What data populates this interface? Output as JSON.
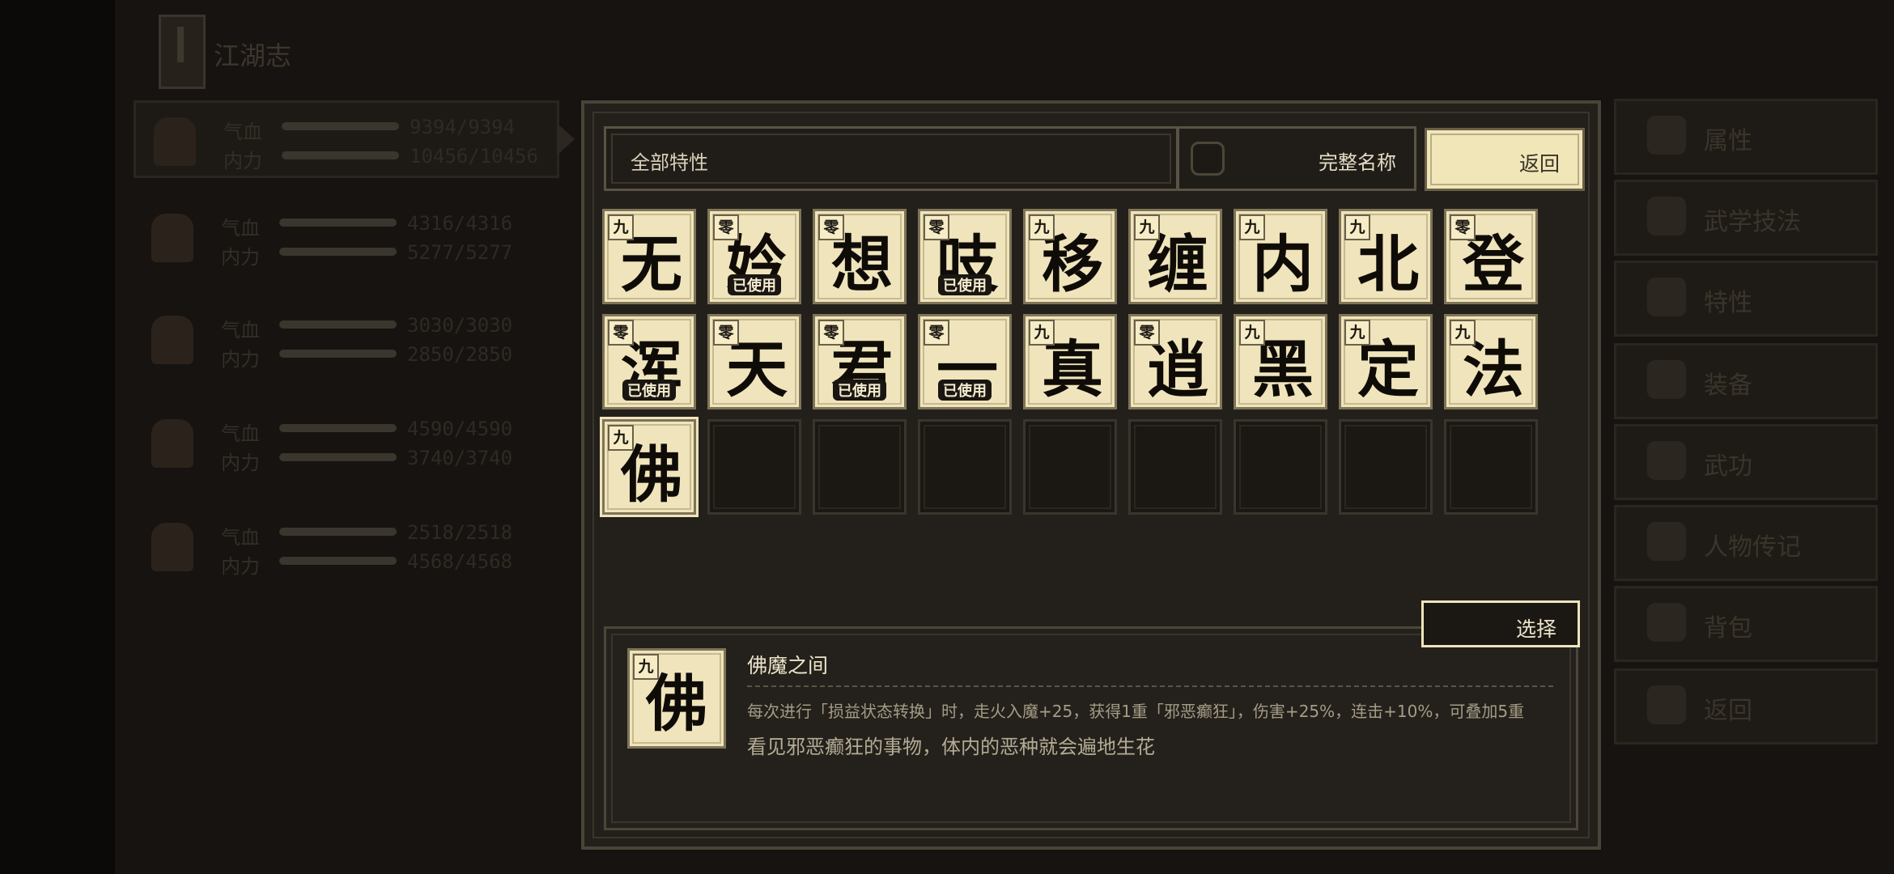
{
  "background": {
    "title": "江湖志",
    "party": [
      {
        "hp_label": "气血",
        "mp_label": "内力",
        "hp": "9394/9394",
        "mp": "10456/10456"
      },
      {
        "hp_label": "气血",
        "mp_label": "内力",
        "hp": "4316/4316",
        "mp": "5277/5277"
      },
      {
        "hp_label": "气血",
        "mp_label": "内力",
        "hp": "3030/3030",
        "mp": "2850/2850"
      },
      {
        "hp_label": "气血",
        "mp_label": "内力",
        "hp": "4590/4590",
        "mp": "3740/3740"
      },
      {
        "hp_label": "气血",
        "mp_label": "内力",
        "hp": "2518/2518",
        "mp": "4568/4568"
      }
    ],
    "menu": [
      "属性",
      "武学技法",
      "特性",
      "装备",
      "武功",
      "人物传记",
      "背包",
      "返回"
    ]
  },
  "modal": {
    "filter_label": "全部特性",
    "fullname_label": "完整名称",
    "fullname_checked": false,
    "back_label": "返回",
    "select_label": "选择",
    "used_label": "已使用",
    "cards": [
      {
        "rank": "九",
        "glyph": "无",
        "used": false
      },
      {
        "rank": "零",
        "glyph": "妗",
        "used": true
      },
      {
        "rank": "零",
        "glyph": "想",
        "used": false
      },
      {
        "rank": "零",
        "glyph": "吱",
        "used": true
      },
      {
        "rank": "九",
        "glyph": "移",
        "used": false
      },
      {
        "rank": "九",
        "glyph": "缠",
        "used": false
      },
      {
        "rank": "九",
        "glyph": "内",
        "used": false
      },
      {
        "rank": "九",
        "glyph": "北",
        "used": false
      },
      {
        "rank": "零",
        "glyph": "登",
        "used": false
      },
      {
        "rank": "零",
        "glyph": "浑",
        "used": true
      },
      {
        "rank": "零",
        "glyph": "天",
        "used": false
      },
      {
        "rank": "零",
        "glyph": "君",
        "used": true
      },
      {
        "rank": "零",
        "glyph": "一",
        "used": true
      },
      {
        "rank": "九",
        "glyph": "真",
        "used": false
      },
      {
        "rank": "零",
        "glyph": "逍",
        "used": false
      },
      {
        "rank": "九",
        "glyph": "黑",
        "used": false
      },
      {
        "rank": "九",
        "glyph": "定",
        "used": false
      },
      {
        "rank": "九",
        "glyph": "法",
        "used": false
      },
      {
        "rank": "九",
        "glyph": "佛",
        "used": false
      }
    ],
    "empty_slots": 8,
    "detail": {
      "rank": "九",
      "glyph": "佛",
      "name": "佛魔之间",
      "effect": "每次进行「损益状态转换」时，走火入魔+25，获得1重「邪恶癫狂」，伤害+25%，连击+10%，可叠加5重",
      "flavor": "看见邪恶癫狂的事物，体内的恶种就会遍地生花"
    }
  },
  "colors": {
    "card_face": "#efe4bb",
    "panel": "#23201b",
    "border": "#4a4438",
    "text_light": "#ede4cb"
  }
}
